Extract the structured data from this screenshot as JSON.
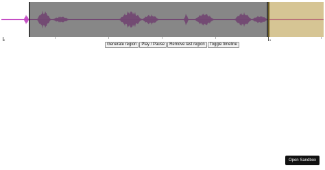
{
  "controls": {
    "generate_region_label": "Generate region",
    "play_pause_label": "Play / Pause",
    "remove_last_region_label": "Remove last region",
    "toggle_timeline_label": "Toggle timeline"
  },
  "timeline": {
    "start_label": "0",
    "mark_label": "5"
  },
  "sandbox": {
    "label": "Open Sandbox"
  },
  "colors": {
    "waveform": "#c040c0",
    "region_1": "#464646",
    "region_2": "#b4963c"
  }
}
